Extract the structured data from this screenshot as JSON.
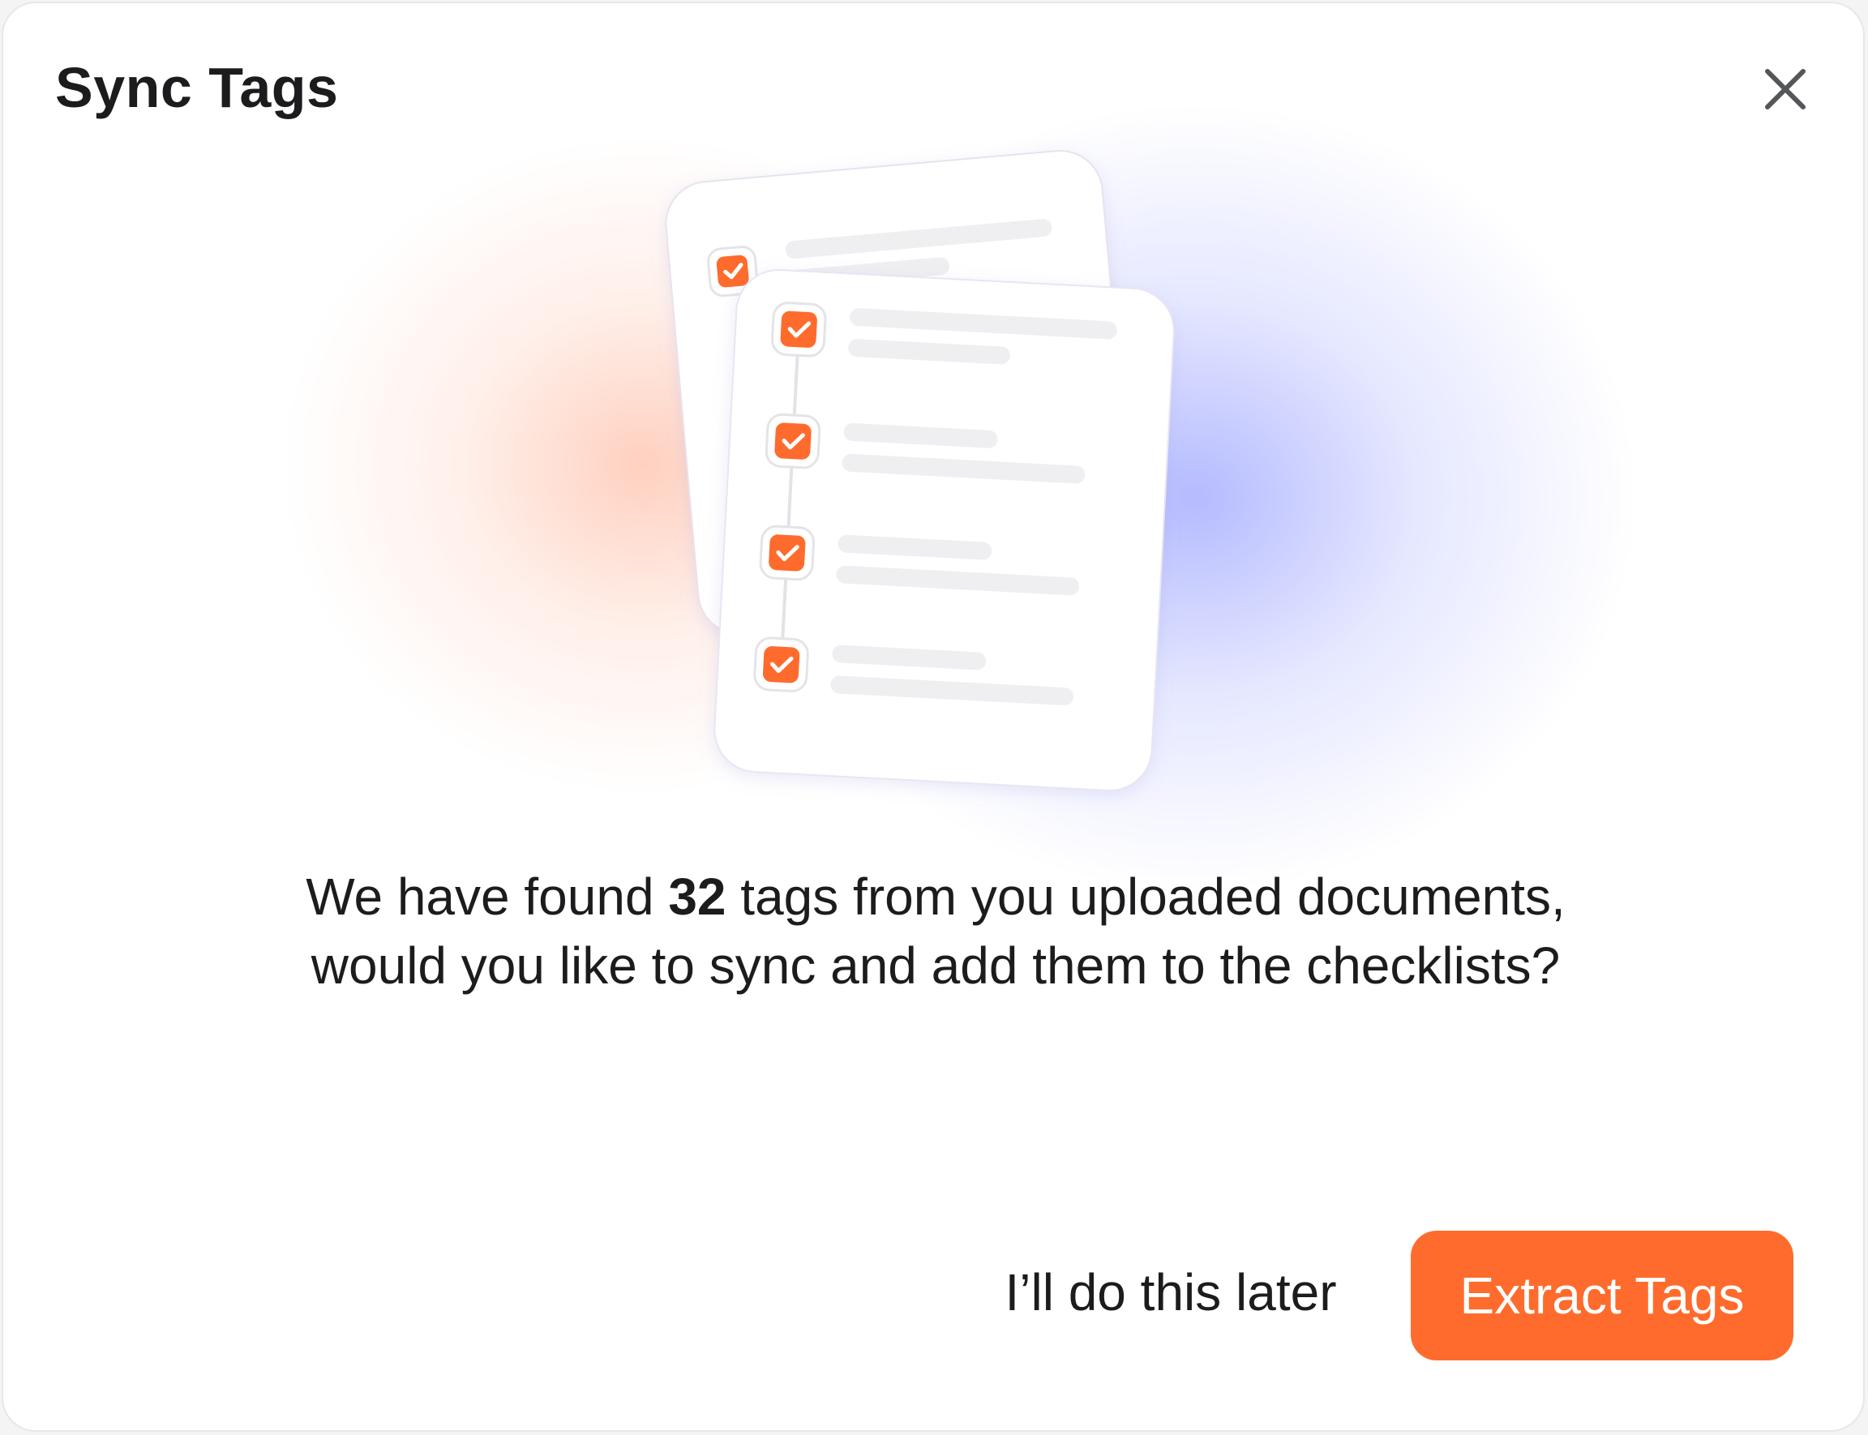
{
  "dialog": {
    "title": "Sync Tags",
    "close_icon": "close-icon",
    "message": {
      "before": "We have found ",
      "count": "32",
      "after": " tags from you uploaded documents, would you like to sync and add them to the checklists?"
    },
    "secondary_button": "I’ll do this later",
    "primary_button": "Extract Tags"
  },
  "illustration": {
    "icon": "checklist-documents-icon",
    "checked_items": 4
  },
  "colors": {
    "accent": "#ff6b2c",
    "text": "#1c1c1e",
    "glow_orange": "#ffb8a0",
    "glow_blue": "#9aa2ff"
  }
}
